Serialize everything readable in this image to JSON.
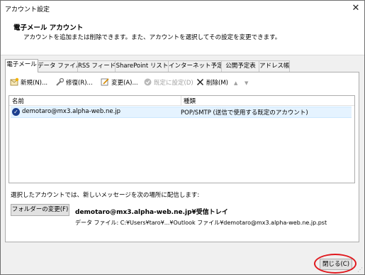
{
  "window": {
    "title": "アカウント設定",
    "close_glyph": "✕"
  },
  "header": {
    "title": "電子メール アカウント",
    "description": "アカウントを追加または削除できます。また、アカウントを選択してその設定を変更できます。"
  },
  "tabs": [
    {
      "label": "電子メール",
      "active": true
    },
    {
      "label": "データ ファイル"
    },
    {
      "label": "RSS フィード"
    },
    {
      "label": "SharePoint リスト"
    },
    {
      "label": "インターネット予定表"
    },
    {
      "label": "公開予定表"
    },
    {
      "label": "アドレス帳"
    }
  ],
  "toolbar": {
    "new_label": "新規(N)...",
    "repair_label": "修復(R)...",
    "change_label": "変更(A)...",
    "default_label": "既定に設定(D)",
    "delete_label": "削除(M)",
    "up_glyph": "▲",
    "down_glyph": "▼"
  },
  "account_list": {
    "columns": [
      "名前",
      "種類"
    ],
    "rows": [
      {
        "name": "demotaro@mx3.alpha-web.ne.jp",
        "type": "POP/SMTP (送信で使用する既定のアカウント)"
      }
    ]
  },
  "delivery": {
    "label": "選択したアカウントでは、新しいメッセージを次の場所に配信します:",
    "change_folder_label": "フォルダーの変更(F)",
    "target": "demotaro@mx3.alpha-web.ne.jp¥受信トレイ",
    "data_file": "データ ファイル: C:¥Users¥taro¥...¥Outlook ファイル¥demotaro@mx3.alpha-web.ne.jp.pst"
  },
  "footer": {
    "close_label": "閉じる(C)",
    "highlight_color": "#e0191e"
  },
  "colors": {
    "selected_row": "#e5f3ff",
    "check_icon": "#1c3f8f"
  }
}
